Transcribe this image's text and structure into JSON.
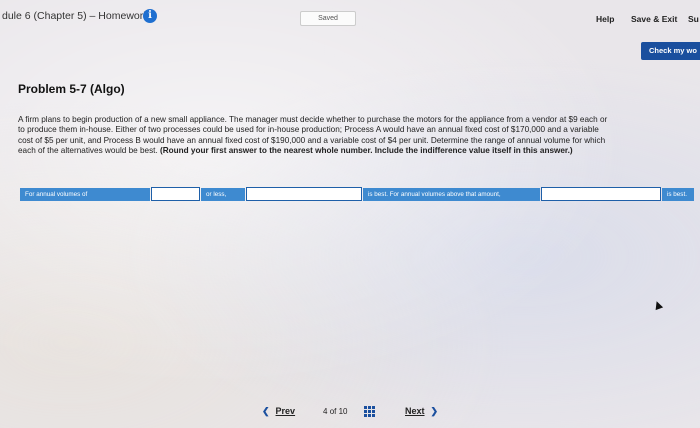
{
  "header": {
    "title": "dule 6 (Chapter 5) – Homework",
    "info_icon": "info-icon",
    "saved_label": "Saved",
    "help_label": "Help",
    "save_exit_label": "Save & Exit",
    "submit_label": "Su",
    "check_label": "Check my wo"
  },
  "problem": {
    "title": "Problem 5-7 (Algo)",
    "text": "A firm plans to begin production of a new small appliance. The manager must decide whether to purchase the motors for the appliance from a vendor at $9 each or to produce them in-house. Either of two processes could be used for in-house production; Process A would have an annual fixed cost of $170,000 and a variable cost of $5 per unit, and Process B would have an annual fixed cost of $190,000 and a variable cost of $4 per unit. Determine the range of annual volume for which each of the alternatives would be best.",
    "instruction": "(Round your first answer to the nearest whole number. Include the indifference value itself in this answer.)"
  },
  "answer_row": {
    "label1": "For annual volumes of",
    "label2": "or less,",
    "label3": "is best. For annual volumes above that amount,",
    "label4": "is best.",
    "input1_value": "",
    "input2_value": "",
    "input3_value": "",
    "input4_value": ""
  },
  "footer": {
    "prev_label": "Prev",
    "page_current": "4",
    "page_of": "of",
    "page_total": "10",
    "next_label": "Next",
    "grid_icon": "grid-icon"
  },
  "colors": {
    "accent": "#1a4f9e",
    "label_bg": "#3e8ad0",
    "info_icon": "#1f6fd0"
  }
}
